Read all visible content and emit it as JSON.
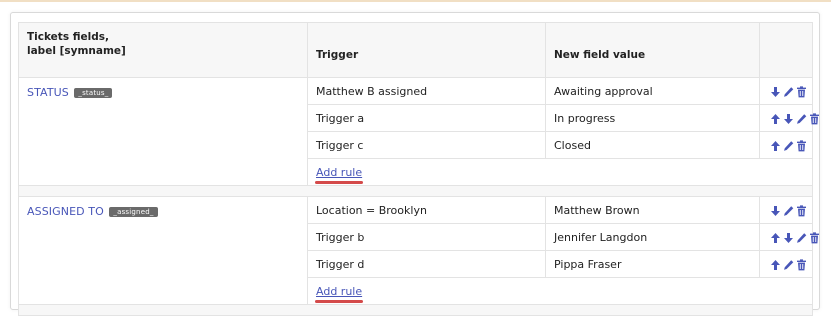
{
  "table": {
    "headers": {
      "field": "Tickets fields,\nlabel [symname]",
      "trigger": "Trigger",
      "value": "New field value"
    },
    "add_rule_label": "Add rule",
    "groups": [
      {
        "label": "STATUS",
        "symname": "_status_",
        "rules": [
          {
            "trigger": "Matthew B assigned",
            "value": "Awaiting approval",
            "actions": [
              "move-down",
              "edit",
              "delete"
            ]
          },
          {
            "trigger": "Trigger a",
            "value": "In progress",
            "actions": [
              "move-up",
              "move-down",
              "edit",
              "delete"
            ]
          },
          {
            "trigger": "Trigger c",
            "value": "Closed",
            "actions": [
              "move-up",
              "edit",
              "delete"
            ]
          }
        ]
      },
      {
        "label": "ASSIGNED TO",
        "symname": "_assigned_",
        "rules": [
          {
            "trigger": "Location = Brooklyn",
            "value": "Matthew Brown",
            "actions": [
              "move-down",
              "edit",
              "delete"
            ]
          },
          {
            "trigger": "Trigger b",
            "value": "Jennifer Langdon",
            "actions": [
              "move-up",
              "move-down",
              "edit",
              "delete"
            ]
          },
          {
            "trigger": "Trigger d",
            "value": "Pippa Fraser",
            "actions": [
              "move-up",
              "edit",
              "delete"
            ]
          }
        ]
      }
    ]
  },
  "icons": {
    "move-up": "arrow-up-icon",
    "move-down": "arrow-down-icon",
    "edit": "pencil-icon",
    "delete": "trash-icon"
  },
  "colors": {
    "link": "#4856b8",
    "underline_highlight": "#d44a4a",
    "badge_bg": "#6a6a6a",
    "header_bg": "#f7f7f7"
  }
}
